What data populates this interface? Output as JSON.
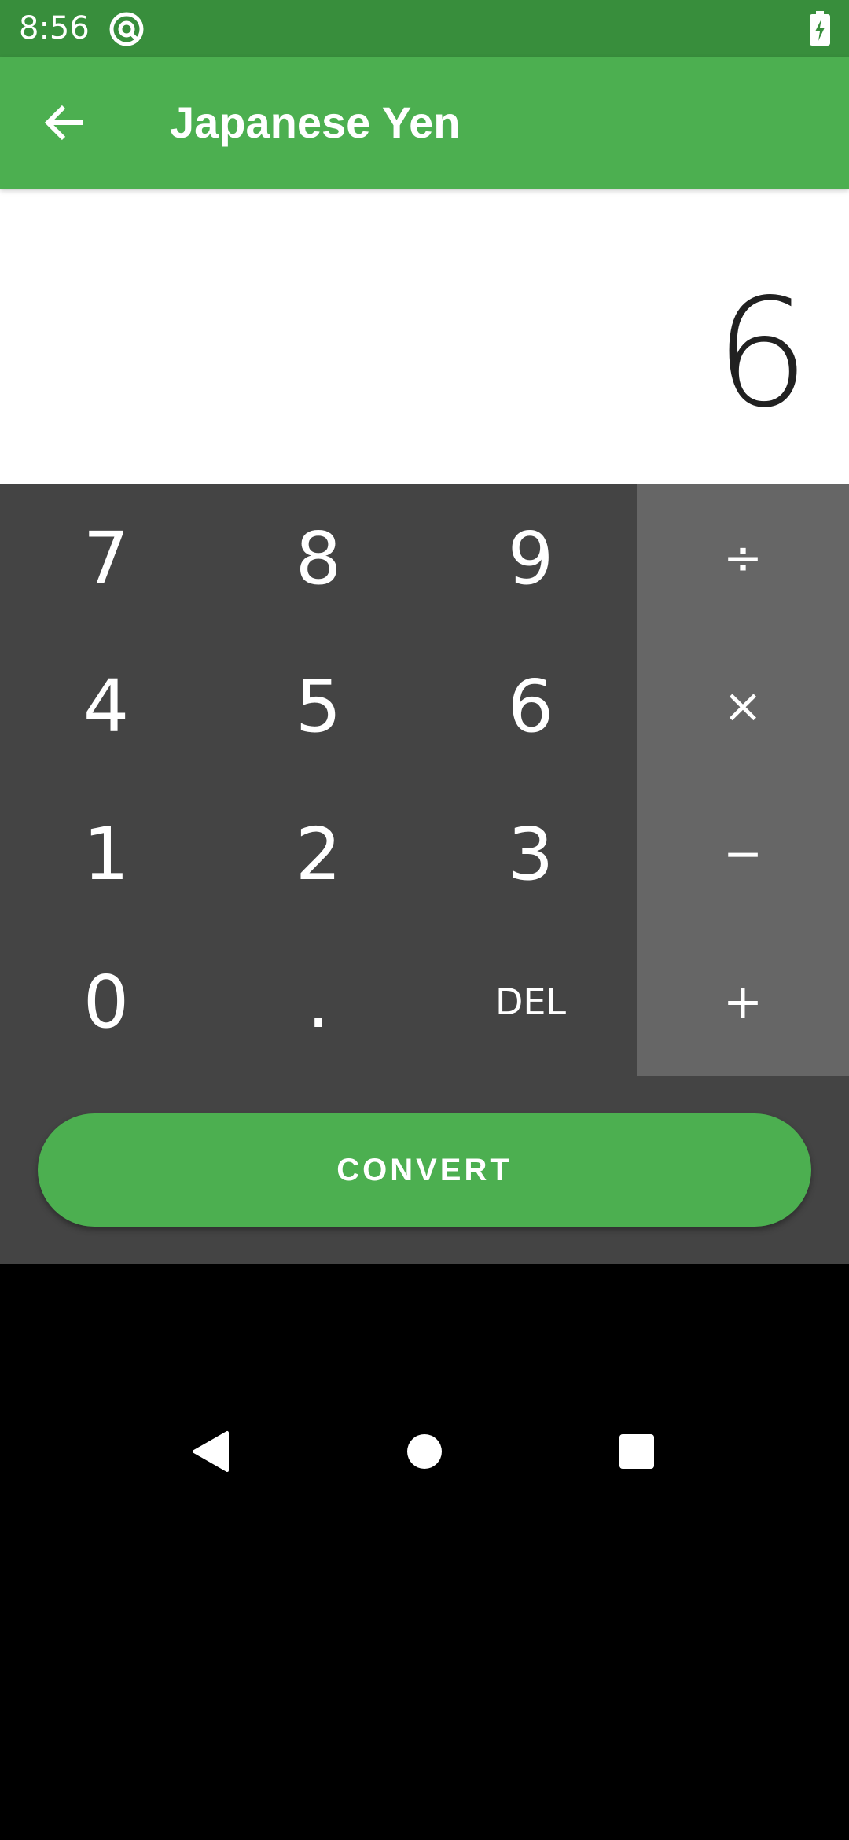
{
  "status_bar": {
    "time": "8:56",
    "icons": [
      "at-sign-icon",
      "battery-charging-icon"
    ]
  },
  "app_bar": {
    "title": "Japanese Yen",
    "back_icon": "arrow-back-icon"
  },
  "display": {
    "value": "6"
  },
  "keypad": {
    "rows": [
      [
        "7",
        "8",
        "9"
      ],
      [
        "4",
        "5",
        "6"
      ],
      [
        "1",
        "2",
        "3"
      ],
      [
        "0",
        ".",
        "DEL"
      ]
    ],
    "operators": [
      "÷",
      "×",
      "−",
      "+"
    ]
  },
  "convert_label": "CONVERT",
  "nav": {
    "icons": [
      "nav-back-icon",
      "nav-home-icon",
      "nav-recents-icon"
    ]
  },
  "colors": {
    "status_bar": "#388E3C",
    "app_bar": "#4CAF50",
    "keypad_bg": "#444444",
    "ops_bg": "#666666",
    "button": "#4CAF50"
  }
}
